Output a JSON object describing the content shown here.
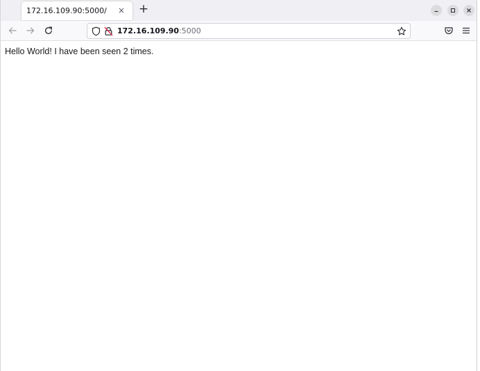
{
  "browser": {
    "tab": {
      "title": "172.16.109.90:5000/",
      "close_glyph": "×"
    },
    "new_tab_glyph": "+",
    "address": {
      "host": "172.16.109.90",
      "port": ":5000"
    }
  },
  "page": {
    "body_text": "Hello World! I have been seen 2 times."
  },
  "icons": {
    "back": "back-arrow-icon",
    "forward": "forward-arrow-icon",
    "reload": "reload-icon",
    "tracking": "tracking-protection-shield-icon",
    "connection": "insecure-lock-icon",
    "bookmark": "bookmark-star-icon",
    "pocket": "pocket-icon",
    "menu": "hamburger-menu-icon"
  },
  "colors": {
    "tabstrip_bg": "#f0f0f4",
    "navbar_bg": "#f9f9fb",
    "insecure_lock_accent": "#e22850"
  }
}
